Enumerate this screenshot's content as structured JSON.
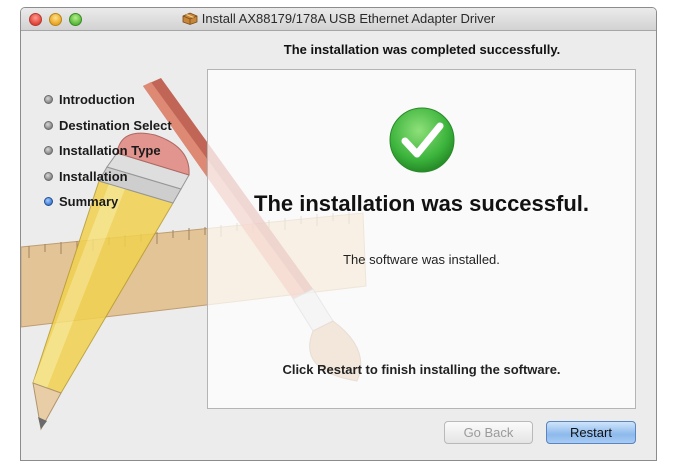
{
  "window": {
    "title": "Install AX88179/178A USB Ethernet Adapter Driver"
  },
  "header": {
    "message": "The installation was completed successfully."
  },
  "sidebar": {
    "steps": [
      {
        "label": "Introduction",
        "active": false
      },
      {
        "label": "Destination Select",
        "active": false
      },
      {
        "label": "Installation Type",
        "active": false
      },
      {
        "label": "Installation",
        "active": false
      },
      {
        "label": "Summary",
        "active": true
      }
    ]
  },
  "content": {
    "success_title": "The installation was successful.",
    "sub_message": "The software was installed.",
    "restart_message": "Click Restart to finish installing the software."
  },
  "buttons": {
    "go_back": "Go Back",
    "restart": "Restart"
  },
  "colors": {
    "accent_blue": "#3f78d8",
    "success_green": "#3cb43c"
  },
  "icons": {
    "window": "package-icon",
    "status": "checkmark-icon"
  }
}
